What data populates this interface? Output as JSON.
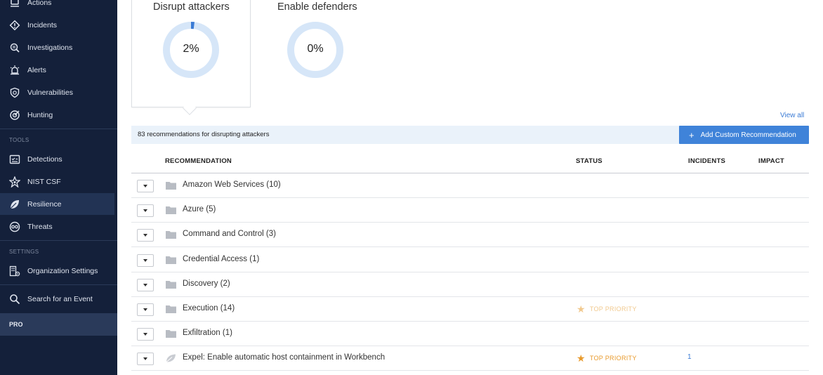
{
  "sidebar": {
    "items_top": [
      {
        "label": "Actions",
        "icon": "actions-icon"
      },
      {
        "label": "Incidents",
        "icon": "incidents-icon"
      },
      {
        "label": "Investigations",
        "icon": "investigations-icon"
      },
      {
        "label": "Alerts",
        "icon": "alerts-icon"
      },
      {
        "label": "Vulnerabilities",
        "icon": "vulnerabilities-icon"
      },
      {
        "label": "Hunting",
        "icon": "hunting-icon"
      }
    ],
    "tools_label": "TOOLS",
    "tools": [
      {
        "label": "Detections",
        "icon": "detections-icon"
      },
      {
        "label": "NIST CSF",
        "icon": "nist-icon"
      },
      {
        "label": "Resilience",
        "icon": "leaf-icon"
      },
      {
        "label": "Threats",
        "icon": "threats-icon"
      }
    ],
    "settings_label": "SETTINGS",
    "settings": [
      {
        "label": "Organization Settings",
        "icon": "org-settings-icon"
      }
    ],
    "search_label": "Search for an Event",
    "pro_label": "PRO"
  },
  "metrics": [
    {
      "title": "Disrupt attackers",
      "value_label": "2%",
      "value": 2
    },
    {
      "title": "Enable defenders",
      "value_label": "0%",
      "value": 0
    }
  ],
  "view_all": "View all",
  "recommendations_count": "83 recommendations for disrupting attackers",
  "add_button": "Add Custom Recommendation",
  "table": {
    "headers": [
      "RECOMMENDATION",
      "STATUS",
      "INCIDENTS",
      "IMPACT"
    ],
    "rows": [
      {
        "label": "Amazon Web Services (10)",
        "type": "folder",
        "status": "",
        "incidents": ""
      },
      {
        "label": "Azure (5)",
        "type": "folder",
        "status": "",
        "incidents": ""
      },
      {
        "label": "Command and Control (3)",
        "type": "folder",
        "status": "",
        "incidents": ""
      },
      {
        "label": "Credential Access (1)",
        "type": "folder",
        "status": "",
        "incidents": ""
      },
      {
        "label": "Discovery (2)",
        "type": "folder",
        "status": "",
        "incidents": ""
      },
      {
        "label": "Execution (14)",
        "type": "folder",
        "status": "TOP PRIORITY",
        "status_faded": true,
        "incidents": ""
      },
      {
        "label": "Exfiltration (1)",
        "type": "folder",
        "status": "",
        "incidents": ""
      },
      {
        "label": "Expel: Enable automatic host containment in Workbench",
        "type": "leaf",
        "status": "TOP PRIORITY",
        "status_faded": false,
        "incidents": "1"
      }
    ]
  },
  "colors": {
    "sidebar_bg": "#14203a",
    "accent_blue": "#3f83d9",
    "donut_track": "#d6e6f8",
    "donut_fill": "#3a7bd5",
    "priority_orange": "#e89a2c"
  }
}
